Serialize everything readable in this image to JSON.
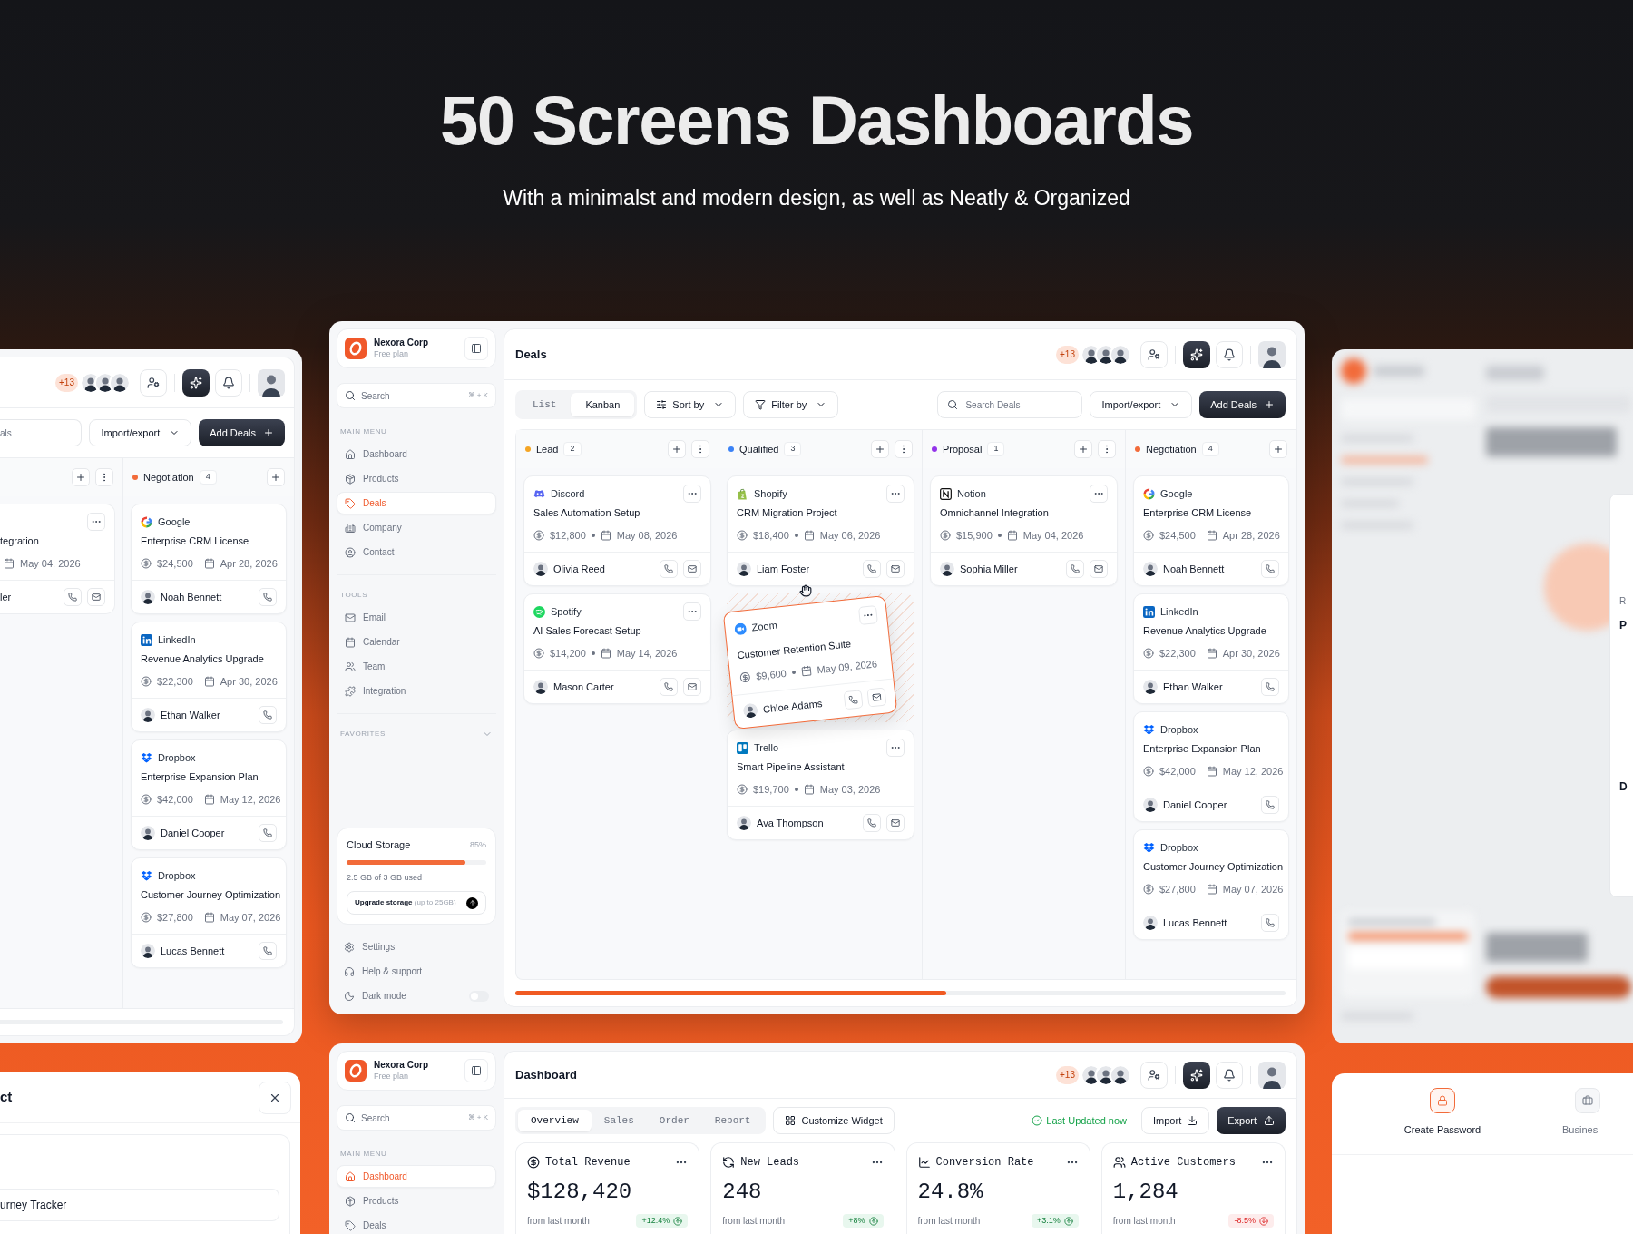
{
  "headline": {
    "title": "50 Screens Dashboards",
    "subtitle": "With a minimalst and modern design, as well as Neatly & Organized"
  },
  "left_screen": {
    "team_extra": "+13",
    "search_fragment": "als",
    "import_export": "Import/export",
    "add_button": "Add Deals",
    "columns": [
      {
        "kind": "fragment",
        "more": true,
        "cards": [
          {
            "kind": "fragment",
            "title": "tegration",
            "date": "May 04, 2026",
            "owner": "ler",
            "menu": true,
            "email": true
          }
        ]
      },
      {
        "kind": "full",
        "name": "Negotiation",
        "color": "#f26b3a",
        "count": "4",
        "more": false,
        "cards": [
          {
            "kind": "google",
            "company": "Google",
            "title": "Enterprise CRM License",
            "amount": "$24,500",
            "date": "Apr 28, 2026",
            "owner": "Noah Bennett",
            "menu": false,
            "email": false
          },
          {
            "kind": "linkedin",
            "company": "LinkedIn",
            "title": "Revenue Analytics Upgrade",
            "amount": "$22,300",
            "date": "Apr 30, 2026",
            "owner": "Ethan Walker",
            "menu": false,
            "email": false
          },
          {
            "kind": "dropbox",
            "company": "Dropbox",
            "title": "Enterprise Expansion Plan",
            "amount": "$42,000",
            "date": "May 12, 2026",
            "owner": "Daniel Cooper",
            "menu": false,
            "email": false
          },
          {
            "kind": "dropbox",
            "company": "Dropbox",
            "title": "Customer Journey Optimization",
            "amount": "$27,800",
            "date": "May 07, 2026",
            "owner": "Lucas Bennett",
            "menu": false,
            "email": false
          }
        ]
      }
    ]
  },
  "deals_screen": {
    "sidebar": {
      "workspace": {
        "name": "Nexora Corp",
        "plan": "Free plan"
      },
      "search": {
        "placeholder": "Search",
        "shortcut": "⌘ + K"
      },
      "menu_sections": [
        {
          "title": "MAIN MENU",
          "items": [
            {
              "label": "Dashboard",
              "selected": false
            },
            {
              "label": "Products",
              "selected": false
            },
            {
              "label": "Deals",
              "selected": true
            },
            {
              "label": "Company",
              "selected": false
            },
            {
              "label": "Contact",
              "selected": false
            }
          ]
        },
        {
          "title": "TOOLS",
          "items": [
            {
              "label": "Email",
              "selected": false
            },
            {
              "label": "Calendar",
              "selected": false
            },
            {
              "label": "Team",
              "selected": false
            },
            {
              "label": "Integration",
              "selected": false
            }
          ]
        }
      ],
      "favorites": {
        "title": "FAVORITES",
        "expanded": false
      },
      "storage": {
        "title": "Cloud Storage",
        "percent": "85%",
        "level": 0.85,
        "usage": "2.5 GB of 3 GB used",
        "upgrade": "**Upgrade storage** (up to 25GB)"
      },
      "footer_items": [
        {
          "kind": "link",
          "label": "Settings"
        },
        {
          "kind": "link",
          "label": "Help & support"
        },
        {
          "kind": "toggle",
          "label": "Dark mode",
          "on": false
        }
      ]
    },
    "page_title": "Deals",
    "team_extra": "+13",
    "view_tabs": [
      {
        "label": "List",
        "selected": false
      },
      {
        "label": "Kanban",
        "selected": true
      }
    ],
    "sort_button": "Sort by",
    "filter_button": "Filter by",
    "search": {
      "placeholder": "Search Deals"
    },
    "import_export": "Import/export",
    "add_button": "Add Deals",
    "columns": [
      {
        "name": "Lead",
        "color": "#f5a524",
        "count": "2",
        "more": true,
        "cards": [
          {
            "kind": "discord",
            "company": "Discord",
            "title": "Sales Automation Setup",
            "amount": "$12,800",
            "date": "May 08, 2026",
            "owner": "Olivia Reed",
            "menu": true,
            "email": true,
            "dragging": false
          },
          {
            "kind": "spotify",
            "company": "Spotify",
            "title": "AI Sales Forecast Setup",
            "amount": "$14,200",
            "date": "May 14, 2026",
            "owner": "Mason Carter",
            "menu": true,
            "email": true,
            "dragging": false
          }
        ]
      },
      {
        "name": "Qualified",
        "color": "#3b82f6",
        "count": "3",
        "more": true,
        "cards": [
          {
            "kind": "shopify",
            "company": "Shopify",
            "title": "CRM Migration Project",
            "amount": "$18,400",
            "date": "May 06, 2026",
            "owner": "Liam Foster",
            "menu": true,
            "email": true,
            "dragging": false
          },
          {
            "kind": "zoom",
            "company": "Zoom",
            "title": "Customer Retention Suite",
            "amount": "$9,600",
            "date": "May 09, 2026",
            "owner": "Chloe Adams",
            "menu": true,
            "email": true,
            "dragging": true
          },
          {
            "kind": "trello",
            "company": "Trello",
            "title": "Smart Pipeline Assistant",
            "amount": "$19,700",
            "date": "May 03, 2026",
            "owner": "Ava Thompson",
            "menu": true,
            "email": true,
            "dragging": false
          }
        ]
      },
      {
        "name": "Proposal",
        "color": "#9333ea",
        "count": "1",
        "more": true,
        "cards": [
          {
            "kind": "notion",
            "company": "Notion",
            "title": "Omnichannel Integration",
            "amount": "$15,900",
            "date": "May 04, 2026",
            "owner": "Sophia Miller",
            "menu": true,
            "email": true,
            "dragging": false
          }
        ]
      },
      {
        "name": "Negotiation",
        "color": "#f26b3a",
        "count": "4",
        "more": false,
        "cards": [
          {
            "kind": "google",
            "company": "Google",
            "title": "Enterprise CRM License",
            "amount": "$24,500",
            "date": "Apr 28, 2026",
            "owner": "Noah Bennett",
            "menu": false,
            "email": false,
            "dragging": false
          },
          {
            "kind": "linkedin",
            "company": "LinkedIn",
            "title": "Revenue Analytics Upgrade",
            "amount": "$22,300",
            "date": "Apr 30, 2026",
            "owner": "Ethan Walker",
            "menu": false,
            "email": false,
            "dragging": false
          },
          {
            "kind": "dropbox",
            "company": "Dropbox",
            "title": "Enterprise Expansion Plan",
            "amount": "$42,000",
            "date": "May 12, 2026",
            "owner": "Daniel Cooper",
            "menu": false,
            "email": false,
            "dragging": false
          },
          {
            "kind": "dropbox",
            "company": "Dropbox",
            "title": "Customer Journey Optimization",
            "amount": "$27,800",
            "date": "May 07, 2026",
            "owner": "Lucas Bennett",
            "menu": false,
            "email": false,
            "dragging": false
          }
        ]
      }
    ]
  },
  "right_screen": {
    "overlay_fragments": [
      "R",
      "P",
      "D"
    ]
  },
  "add_dialog": {
    "title": "ct",
    "field_value": "urney Tracker"
  },
  "dashboard_screen": {
    "sidebar": {
      "workspace": {
        "name": "Nexora Corp",
        "plan": "Free plan"
      },
      "search": {
        "placeholder": "Search",
        "shortcut": "⌘ + K"
      },
      "menu_sections": [
        {
          "title": "MAIN MENU",
          "items": [
            {
              "label": "Dashboard",
              "selected": true
            },
            {
              "label": "Products",
              "selected": false
            },
            {
              "label": "Deals",
              "selected": false
            }
          ]
        }
      ]
    },
    "page_title": "Dashboard",
    "team_extra": "+13",
    "tabs": [
      {
        "label": "Overview",
        "selected": true
      },
      {
        "label": "Sales",
        "selected": false
      },
      {
        "label": "Order",
        "selected": false
      },
      {
        "label": "Report",
        "selected": false
      }
    ],
    "customize_button": "Customize Widget",
    "status": "Last Updated now",
    "import_button": "Import",
    "export_button": "Export",
    "stats": [
      {
        "title": "Total Revenue",
        "value": "$128,420",
        "note": "from last month",
        "change": "+12.4%",
        "up": true
      },
      {
        "title": "New Leads",
        "value": "248",
        "note": "from last month",
        "change": "+8%",
        "up": true
      },
      {
        "title": "Conversion Rate",
        "value": "24.8%",
        "note": "from last month",
        "change": "+3.1%",
        "up": true
      },
      {
        "title": "Active Customers",
        "value": "1,284",
        "note": "from last month",
        "change": "-8.5%",
        "up": false
      }
    ]
  },
  "onboarding": {
    "steps": [
      {
        "label": "Create Password",
        "selected": true
      },
      {
        "label": "Busines",
        "selected": false
      }
    ]
  }
}
